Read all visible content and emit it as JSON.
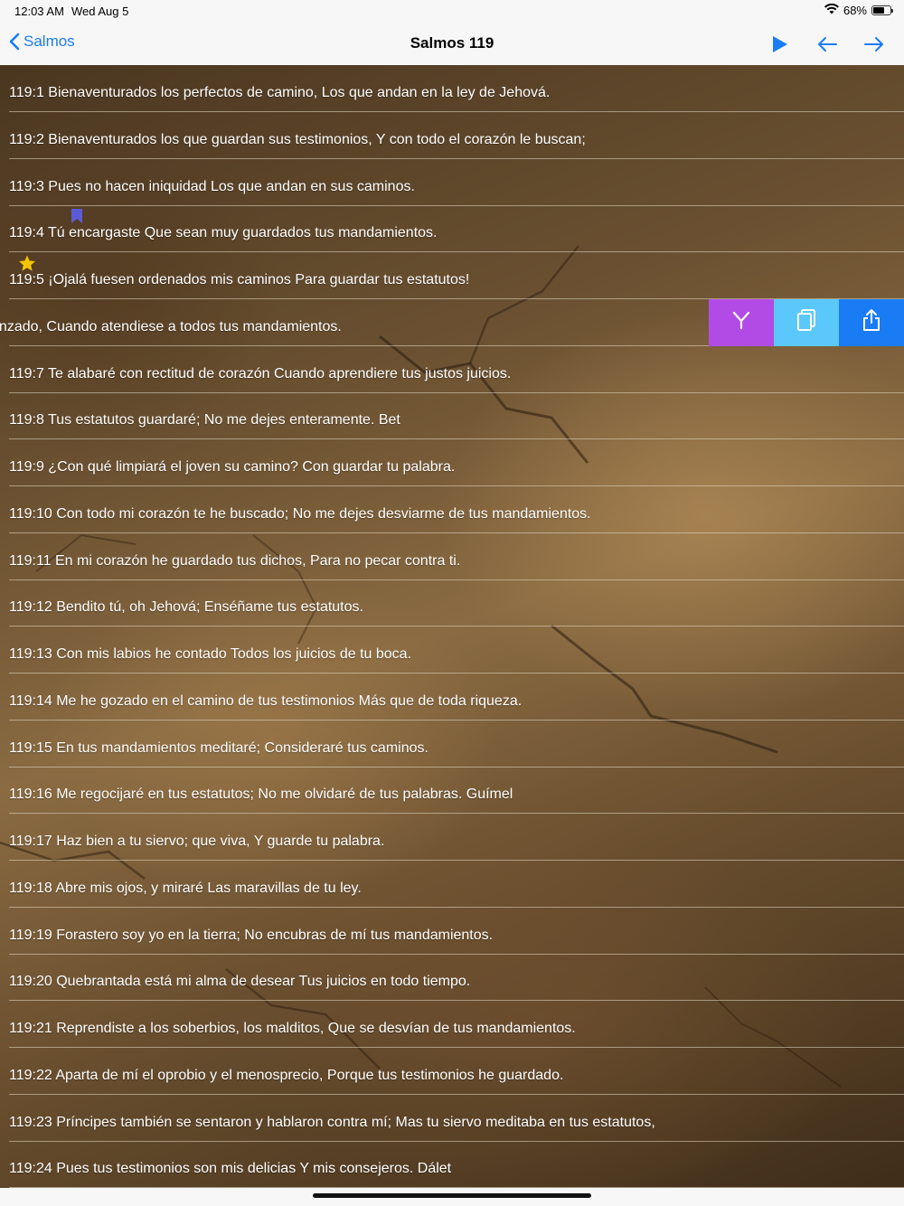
{
  "status_bar": {
    "time": "12:03 AM",
    "date": "Wed Aug 5",
    "battery": "68%",
    "battery_level": 0.68
  },
  "nav": {
    "back_label": "Salmos",
    "title": "Salmos 119",
    "icons": [
      "play-icon",
      "arrow-left-icon",
      "arrow-right-icon"
    ]
  },
  "colors": {
    "accent": "#1a7cf5",
    "action_purple": "#b24be6",
    "action_lightblue": "#5ac8fa",
    "action_blue": "#1a7cf5",
    "bookmark": "#5b5bd6",
    "star": "#f5c400"
  },
  "verses": [
    {
      "text": "119:1 Bienaventurados los perfectos de camino, Los que andan en la ley de Jehová."
    },
    {
      "text": "119:2 Bienaventurados los que guardan sus testimonios, Y con todo el corazón le buscan;"
    },
    {
      "text": "119:3 Pues no hacen iniquidad Los que andan en sus caminos."
    },
    {
      "text": "119:4 Tú encargaste Que sean muy guardados tus mandamientos.",
      "bookmark": true
    },
    {
      "text": "119:5 ¡Ojalá fuesen ordenados mis caminos Para guardar tus estatutos!",
      "star": true
    },
    {
      "text": "avergonzado, Cuando atendiese a todos tus mandamientos.",
      "swiped": true
    },
    {
      "text": "119:7 Te alabaré con rectitud de corazón Cuando aprendiere tus justos juicios."
    },
    {
      "text": "119:8 Tus estatutos guardaré; No me dejes enteramente. Bet"
    },
    {
      "text": "119:9 ¿Con qué limpiará el joven su camino? Con guardar tu palabra."
    },
    {
      "text": "119:10 Con todo mi corazón te he buscado; No me dejes desviarme de tus mandamientos."
    },
    {
      "text": "119:11 En mi corazón he guardado tus dichos, Para no pecar contra ti."
    },
    {
      "text": "119:12 Bendito tú, oh Jehová; Enséñame tus estatutos."
    },
    {
      "text": "119:13 Con mis labios he contado Todos los juicios de tu boca."
    },
    {
      "text": "119:14 Me he gozado en el camino de tus testimonios Más que de toda riqueza."
    },
    {
      "text": "119:15 En tus mandamientos meditaré; Consideraré tus caminos."
    },
    {
      "text": "119:16 Me regocijaré en tus estatutos; No me olvidaré de tus palabras. Guímel"
    },
    {
      "text": "119:17 Haz bien a tu siervo; que viva, Y guarde tu palabra."
    },
    {
      "text": "119:18 Abre mis ojos, y miraré Las maravillas de tu ley."
    },
    {
      "text": "119:19 Forastero soy yo en la tierra; No encubras de mí tus mandamientos."
    },
    {
      "text": "119:20 Quebrantada está mi alma de desear Tus juicios en todo tiempo."
    },
    {
      "text": "119:21 Reprendiste a los soberbios, los malditos, Que se desvían de tus mandamientos."
    },
    {
      "text": "119:22 Aparta de mí el oprobio y el menosprecio, Porque tus testimonios he guardado."
    },
    {
      "text": "119:23 Príncipes también se sentaron y hablaron contra mí; Mas tu siervo meditaba en tus estatutos,"
    },
    {
      "text": "119:24 Pues tus testimonios son mis delicias Y mis consejeros. Dálet"
    }
  ],
  "swipe_actions": [
    {
      "name": "compare-icon",
      "color": "#b24be6"
    },
    {
      "name": "copy-icon",
      "color": "#5ac8fa"
    },
    {
      "name": "share-icon",
      "color": "#1a7cf5"
    }
  ]
}
